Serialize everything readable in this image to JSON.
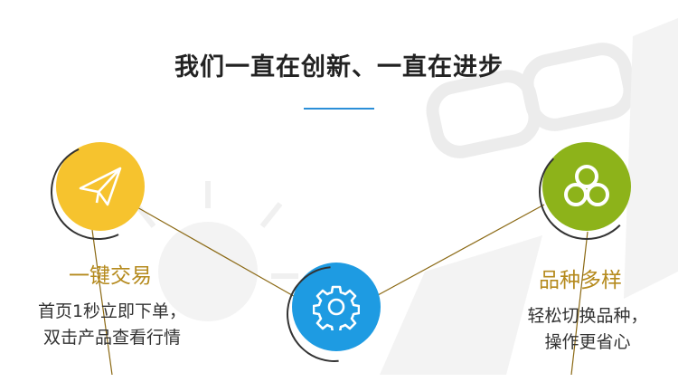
{
  "headline": "我们一直在创新、一直在进步",
  "features": [
    {
      "icon": "paper-plane-icon",
      "color": "#f6c32e",
      "title": "一键交易",
      "desc_line1": "首页1秒立即下单，",
      "desc_line2": "双击产品查看行情"
    },
    {
      "icon": "gear-icon",
      "color": "#1e9be2"
    },
    {
      "icon": "three-circles-icon",
      "color": "#8db31a",
      "title": "品种多样",
      "desc_line1": "轻松切换品种，",
      "desc_line2": "操作更省心"
    }
  ],
  "colors": {
    "accent_line": "#2b8fd8",
    "title_gold": "#b58a1d",
    "connector": "#8b6914"
  }
}
